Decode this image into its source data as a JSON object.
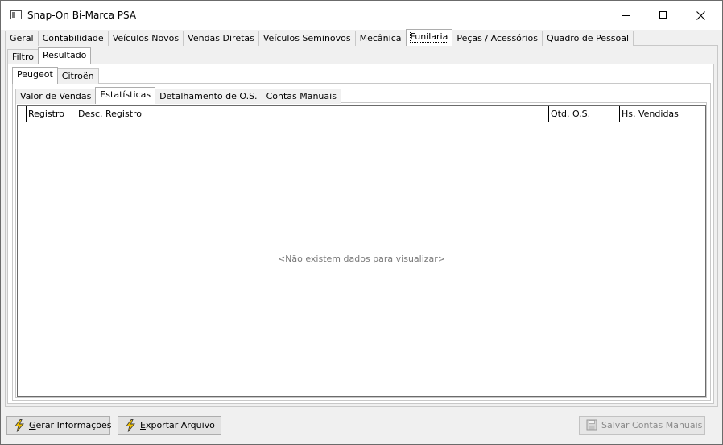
{
  "window": {
    "title": "Snap-On Bi-Marca PSA"
  },
  "main_tabs": [
    "Geral",
    "Contabilidade",
    "Veículos Novos",
    "Vendas Diretas",
    "Veículos Seminovos",
    "Mecânica",
    "Funilaria",
    "Peças / Acessórios",
    "Quadro de Pessoal"
  ],
  "main_tab_active": "Funilaria",
  "sub_tabs": [
    "Filtro",
    "Resultado"
  ],
  "sub_tab_active": "Resultado",
  "brand_tabs": [
    "Peugeot",
    "Citroën"
  ],
  "brand_tab_active": "Peugeot",
  "report_tabs": [
    "Valor de Vendas",
    "Estatísticas",
    "Detalhamento de O.S.",
    "Contas Manuais"
  ],
  "report_tab_active": "Estatísticas",
  "grid": {
    "columns": [
      "Registro",
      "Desc. Registro",
      "Qtd. O.S.",
      "Hs. Vendidas"
    ],
    "empty_message": "<Não existem dados para visualizar>"
  },
  "footer": {
    "gerar_label_u": "G",
    "gerar_label_rest": "erar Informações",
    "exportar_label_u": "E",
    "exportar_label_rest": "xportar Arquivo",
    "salvar_label": "Salvar Contas Manuais"
  },
  "colors": {
    "icon_lightning": "#f2c200",
    "border": "#adadad"
  }
}
